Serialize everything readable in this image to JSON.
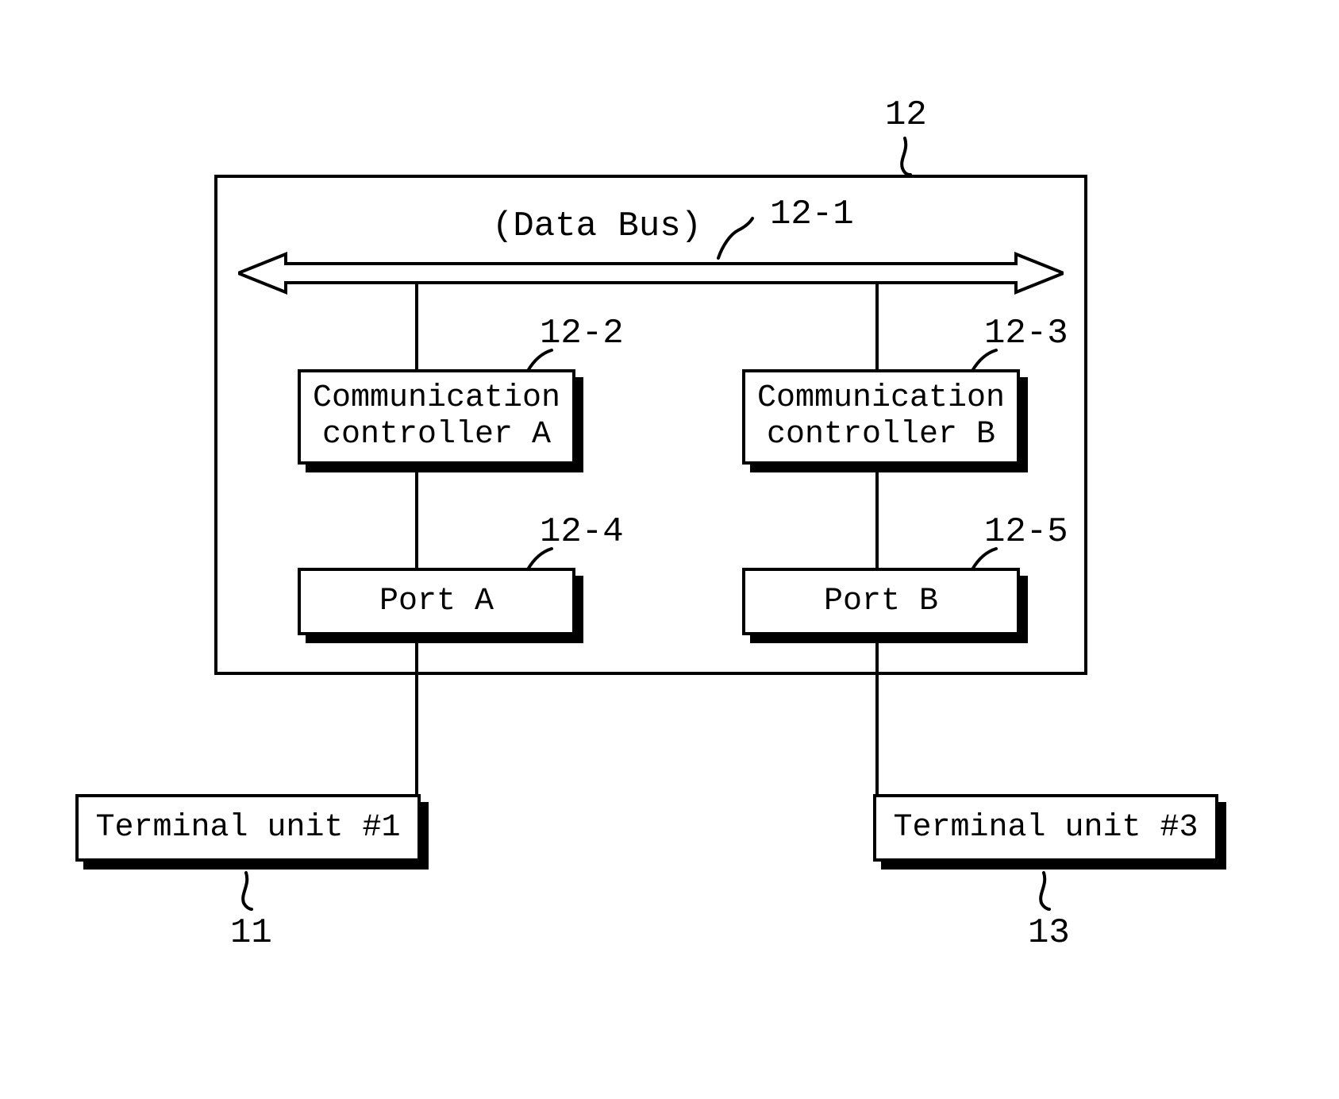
{
  "outer": {
    "ref": "12",
    "bus_ref": "12-1",
    "bus_label": "(Data Bus)",
    "controllerA": {
      "ref": "12-2",
      "label_l1": "Communication",
      "label_l2": "controller A"
    },
    "controllerB": {
      "ref": "12-3",
      "label_l1": "Communication",
      "label_l2": "controller B"
    },
    "portA": {
      "ref": "12-4",
      "label": "Port A"
    },
    "portB": {
      "ref": "12-5",
      "label": "Port B"
    }
  },
  "terminal1": {
    "ref": "11",
    "label": "Terminal unit #1"
  },
  "terminal3": {
    "ref": "13",
    "label": "Terminal unit #3"
  }
}
